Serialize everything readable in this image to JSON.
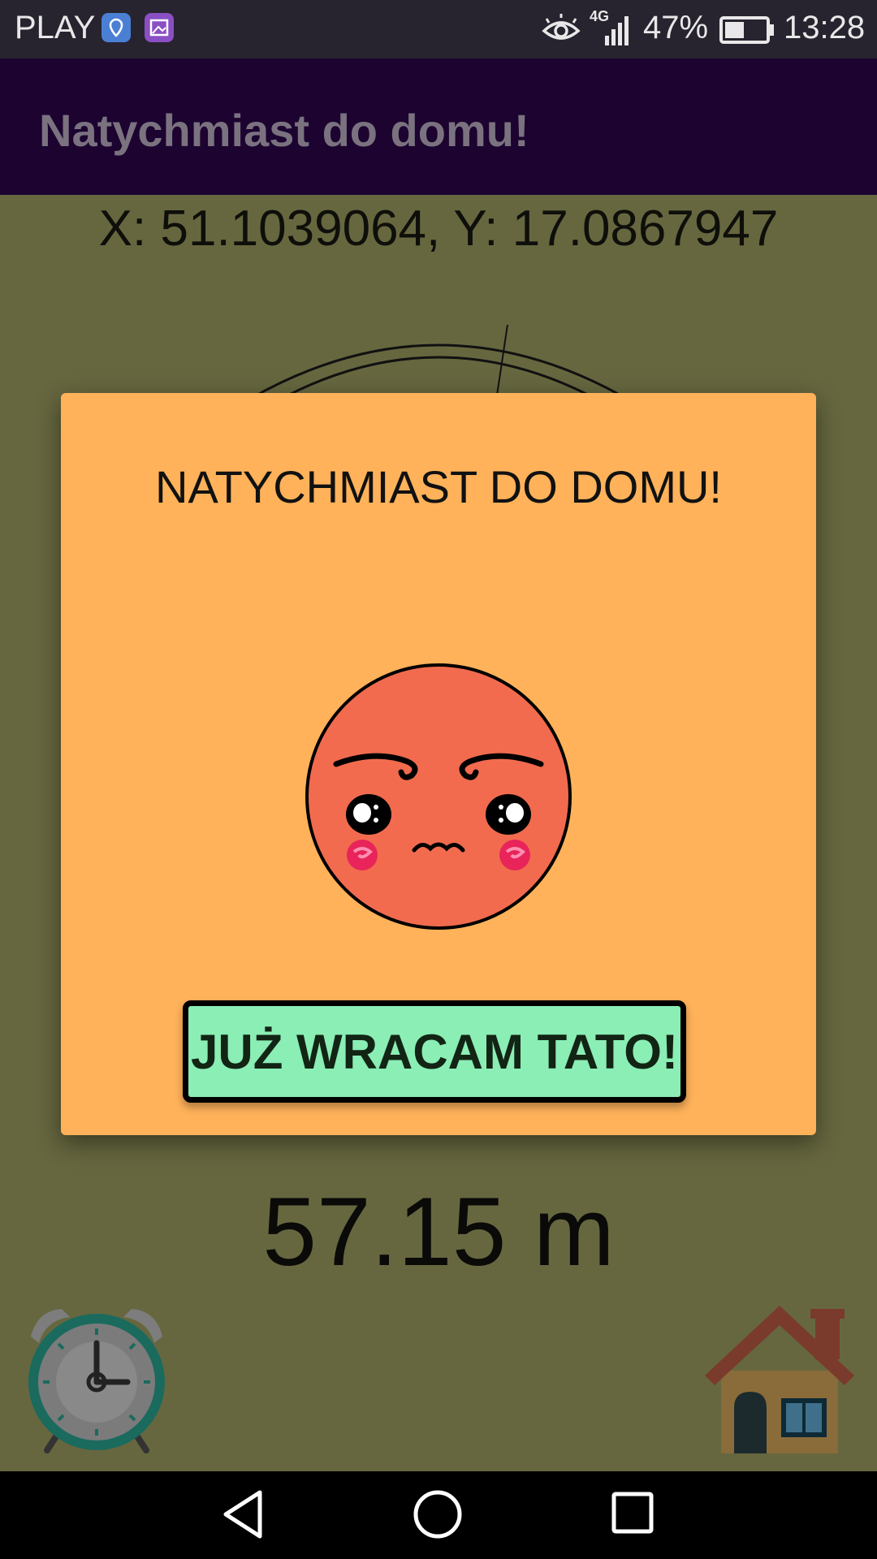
{
  "status_bar": {
    "carrier": "PLAY",
    "battery_percent": "47%",
    "battery_level": 0.47,
    "network": "4G",
    "time": "13:28",
    "icons": [
      "location-icon",
      "gallery-icon",
      "eye-icon",
      "signal-icon",
      "battery-icon"
    ]
  },
  "app_bar": {
    "title": "Natychmiast do domu!"
  },
  "main": {
    "coordinates": "X: 51.1039064, Y: 17.0867947",
    "distance": "57.15 m",
    "icons": [
      "compass-icon",
      "alarm-clock-icon",
      "house-icon"
    ]
  },
  "dialog": {
    "title": "NATYCHMIAST DO DOMU!",
    "image_icon": "angry-face-icon",
    "button_label": "JUŻ WRACAM TATO!"
  },
  "nav_bar": {
    "icons": [
      "back-icon",
      "home-icon",
      "recents-icon"
    ]
  },
  "colors": {
    "status_bar": "#27242f",
    "app_bar": "#1c0330",
    "app_title": "#7b7280",
    "background": "#66673f",
    "dialog": "#ffb25a",
    "button": "#8aeeb5",
    "face": "#f26b4e"
  }
}
